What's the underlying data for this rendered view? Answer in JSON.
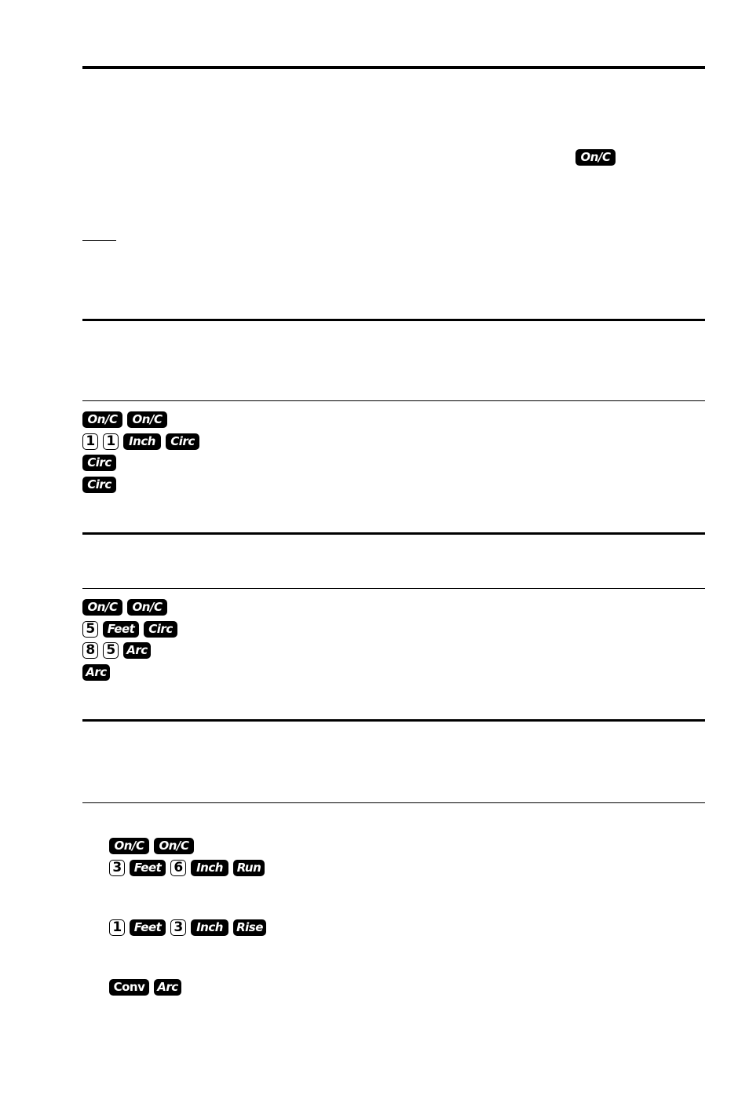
{
  "intro": {
    "inline_key": "On/C"
  },
  "example1": {
    "rows": [
      [
        "On/C",
        "On/C"
      ],
      [
        "1",
        "1",
        "Inch",
        "Circ"
      ],
      [
        "Circ"
      ],
      [
        "Circ"
      ]
    ]
  },
  "example2": {
    "rows": [
      [
        "On/C",
        "On/C"
      ],
      [
        "5",
        "Feet",
        "Circ"
      ],
      [
        "8",
        "5",
        "Arc"
      ],
      [
        "Arc"
      ]
    ]
  },
  "example3": {
    "rows": [
      [
        "On/C",
        "On/C"
      ],
      [
        "3",
        "Feet",
        "6",
        "Inch",
        "Run"
      ],
      [
        "1",
        "Feet",
        "3",
        "Inch",
        "Rise"
      ],
      [
        "Conv",
        "Arc"
      ]
    ]
  }
}
